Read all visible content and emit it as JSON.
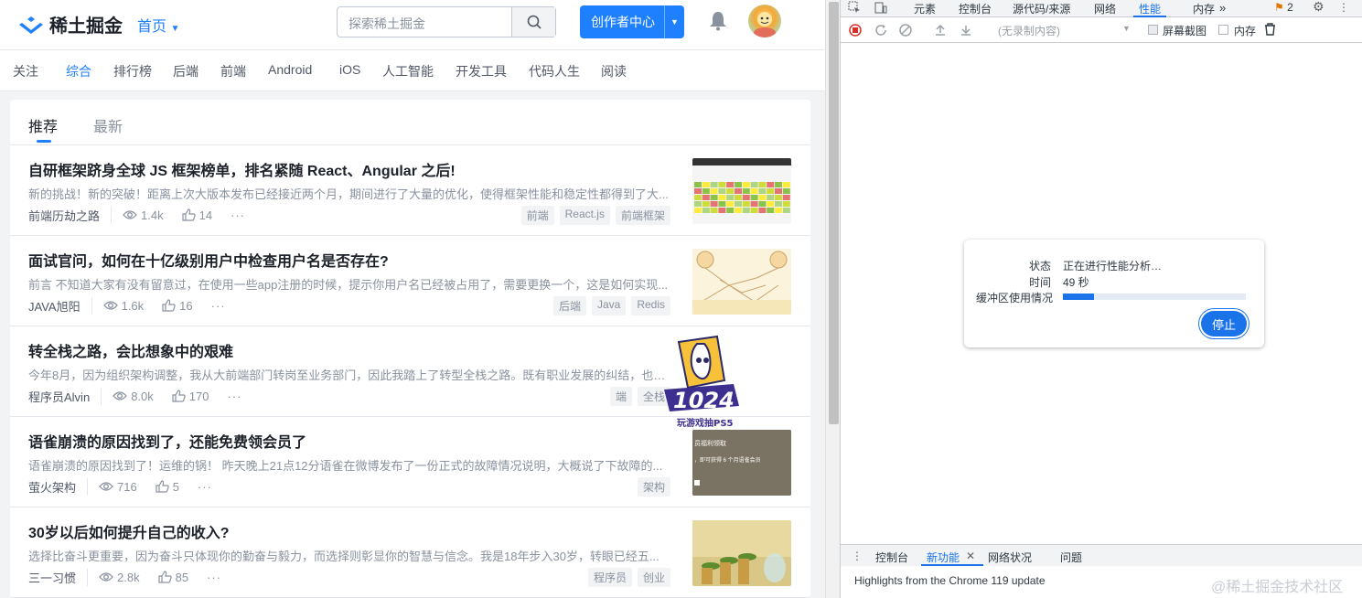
{
  "header": {
    "logo_text": "稀土掘金",
    "home_nav": "首页",
    "search_placeholder": "探索稀土掘金",
    "creator_button": "创作者中心"
  },
  "categories": [
    "关注",
    "综合",
    "排行榜",
    "后端",
    "前端",
    "Android",
    "iOS",
    "人工智能",
    "开发工具",
    "代码人生",
    "阅读"
  ],
  "active_category": "综合",
  "feed_tabs": [
    "推荐",
    "最新"
  ],
  "articles": [
    {
      "title": "自研框架跻身全球 JS 框架榜单，排名紧随 React、Angular 之后!",
      "abstract": "新的挑战！新的突破！距离上次大版本发布已经接近两个月，期间进行了大量的优化，使得框架性能和稳定性都得到了大...",
      "author": "前端历劫之路",
      "views": "1.4k",
      "likes": "14",
      "tags": [
        "前端",
        "React.js",
        "前端框架"
      ]
    },
    {
      "title": "面试官问，如何在十亿级别用户中检查用户名是否存在?",
      "abstract": "前言 不知道大家有没有留意过，在使用一些app注册的时候，提示你用户名已经被占用了，需要更换一个，这是如何实现...",
      "author": "JAVA旭阳",
      "views": "1.6k",
      "likes": "16",
      "tags": [
        "后端",
        "Java",
        "Redis"
      ]
    },
    {
      "title": "转全栈之路，会比想象中的艰难",
      "abstract": "今年8月，因为组织架构调整，我从大前端部门转岗至业务部门，因此我踏上了转型全栈之路。既有职业发展的纠结，也有点... 说~",
      "author": "程序员Alvin",
      "views": "8.0k",
      "likes": "170",
      "tags": [
        "端",
        "全栈"
      ]
    },
    {
      "title": "语雀崩溃的原因找到了，还能免费领会员了",
      "abstract": "语雀崩溃的原因找到了！运维的锅！ 昨天晚上21点12分语雀在微博发布了一份正式的故障情况说明，大概说了下故障的...",
      "author": "萤火架构",
      "views": "716",
      "likes": "5",
      "tags": [
        "架构"
      ]
    },
    {
      "title": "30岁以后如何提升自己的收入?",
      "abstract": "选择比奋斗更重要，因为奋斗只体现你的勤奋与毅力，而选择则彰显你的智慧与信念。我是18年步入30岁，转眼已经五...",
      "author": "三一习惯",
      "views": "2.8k",
      "likes": "85",
      "tags": [
        "程序员",
        "创业"
      ]
    }
  ],
  "thumb_text": {
    "yuque_line1": "员福利领取",
    "yuque_line2": "，即可获得 6 个月语雀会员"
  },
  "badge": {
    "number": "1024",
    "caption": "玩游戏抽PS5"
  },
  "devtools": {
    "tabs": [
      "元素",
      "控制台",
      "源代码/来源",
      "网络",
      "性能",
      "内存"
    ],
    "active_tab": "性能",
    "issues_count": "2",
    "recording_select": "(无录制内容)",
    "screenshots_label": "屏幕截图",
    "memory_label": "内存",
    "status_label": "状态",
    "status_value": "正在进行性能分析…",
    "time_label": "时间",
    "time_value": "49 秒",
    "buffer_label": "缓冲区使用情况",
    "buffer_fraction": 0.17,
    "stop_button": "停止",
    "drawer_tabs": [
      "控制台",
      "新功能",
      "网络状况",
      "问题"
    ],
    "drawer_active": "新功能",
    "drawer_message": "Highlights from the Chrome 119 update"
  },
  "watermark": "@稀土掘金技术社区",
  "colors": {
    "brand": "#1e80ff",
    "devtools_accent": "#1a73e8"
  }
}
